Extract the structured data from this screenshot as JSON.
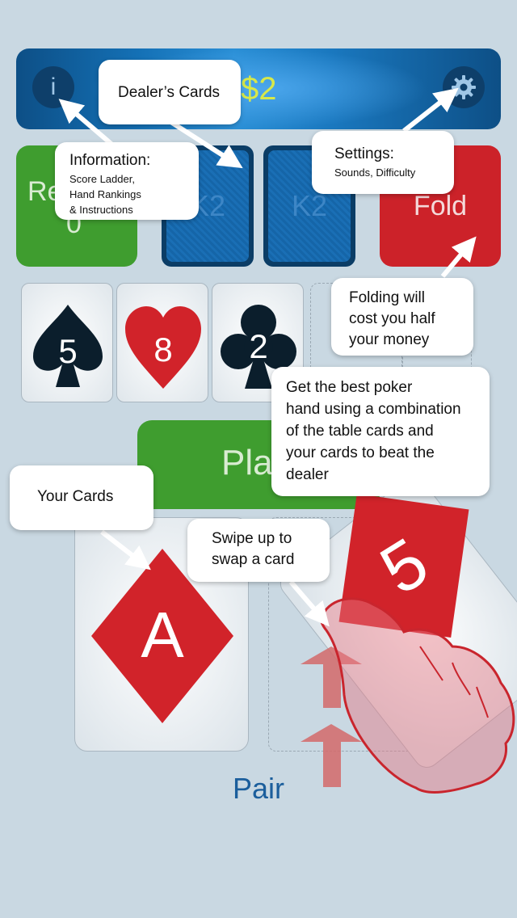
{
  "header": {
    "info_glyph": "i",
    "money": "$2",
    "settings_icon": "gear-icon"
  },
  "buttons": {
    "left_label": "Re",
    "left_value": "0",
    "fold": "Fold",
    "play": "Pla"
  },
  "dealer_cards": [
    {
      "label": "K2"
    },
    {
      "label": "K2"
    }
  ],
  "table_cards": [
    {
      "rank": "5",
      "suit": "spade",
      "color": "#0b1e2c"
    },
    {
      "rank": "8",
      "suit": "heart",
      "color": "#d1232a"
    },
    {
      "rank": "2",
      "suit": "club",
      "color": "#0b1e2c"
    }
  ],
  "your_cards": [
    {
      "rank": "A",
      "suit": "diamond",
      "color": "#d1232a"
    },
    {
      "rank": "5",
      "suit": "diamond",
      "color": "#d1232a"
    }
  ],
  "hand_result": "Pair",
  "tutorial": {
    "dealer_cards": "Dealer’s Cards",
    "information_title": "Information:",
    "information_line1": "Score Ladder,",
    "information_line2": "Hand Rankings",
    "information_line3": "& Instructions",
    "settings_title": "Settings:",
    "settings_sub": "Sounds, Difficulty",
    "folding_line1": "Folding will",
    "folding_line2": "cost you half",
    "folding_line3": "your money",
    "best_line1": "Get the best poker",
    "best_line2": "hand using a combination",
    "best_line3": "of the table cards and",
    "best_line4": "your cards to beat the",
    "best_line5": "dealer",
    "your_cards": "Your Cards",
    "swipe_line1": "Swipe up to",
    "swipe_line2": "swap a card"
  },
  "colors": {
    "background": "#c9d8e2",
    "green": "#3f9d2f",
    "red": "#cc2229",
    "blue": "#1470b5",
    "money": "#d7e84a",
    "hand_label": "#1b5e9c"
  }
}
